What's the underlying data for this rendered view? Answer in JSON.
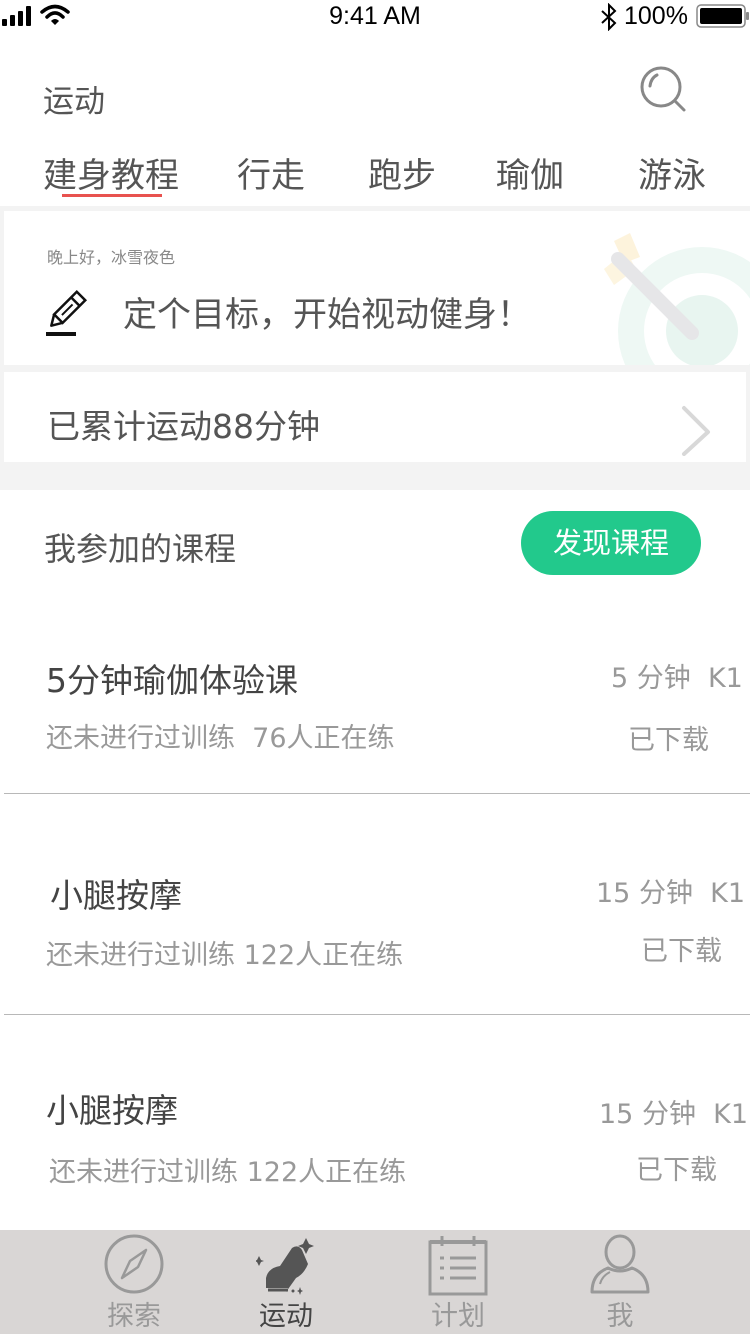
{
  "status_bar": {
    "time": "9:41 AM",
    "battery": "100%",
    "icons": [
      "signal-icon",
      "wifi-icon",
      "bluetooth-icon",
      "battery-icon"
    ]
  },
  "header": {
    "title": "运动",
    "search_icon": "search-icon"
  },
  "tabs": {
    "active_index": 0,
    "active_color": "#e8524f",
    "items": [
      {
        "label": "建身教程"
      },
      {
        "label": "行走"
      },
      {
        "label": "跑步"
      },
      {
        "label": "瑜伽"
      },
      {
        "label": "游泳"
      }
    ]
  },
  "greeting": {
    "text": "晚上好，冰雪夜色",
    "goal": "定个目标，开始视动健身！",
    "icon": "pencil-icon",
    "illustration": "target-arrow-illustration"
  },
  "total": {
    "text": "已累计运动88分钟",
    "icon": "chevron-right-icon"
  },
  "courses_section": {
    "title": "我参加的课程",
    "discover_button": "发现课程",
    "accent_color": "#22c98c"
  },
  "courses": [
    {
      "name": "5分钟瑜伽体验课",
      "progress": "还未进行过训练",
      "participants": "76人正在练",
      "duration": "5 分钟",
      "level": "K1",
      "status": "已下载"
    },
    {
      "name": "小腿按摩",
      "progress": "还未进行过训练",
      "participants": "122人正在练",
      "duration": "15 分钟",
      "level": "K1",
      "status": "已下载"
    },
    {
      "name": "小腿按摩",
      "progress": "还未进行过训练",
      "participants": "122人正在练",
      "duration": "15 分钟",
      "level": "K1",
      "status": "已下载"
    }
  ],
  "bottom_nav": {
    "active_index": 1,
    "items": [
      {
        "label": "探索",
        "icon": "compass-icon"
      },
      {
        "label": "运动",
        "icon": "sneaker-icon"
      },
      {
        "label": "计划",
        "icon": "calendar-list-icon"
      },
      {
        "label": "我",
        "icon": "user-icon"
      }
    ]
  }
}
